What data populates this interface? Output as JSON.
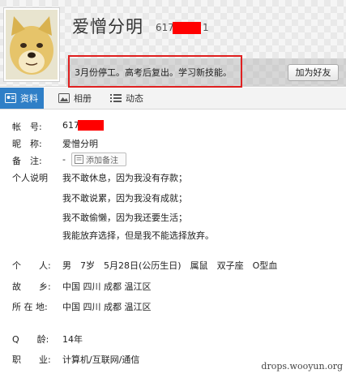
{
  "header": {
    "nickname": "爱憎分明",
    "uid_prefix": "617",
    "uid_suffix": "1",
    "signature": "3月份停工。高考后复出。学习新技能。",
    "add_friend_label": "加为好友",
    "redaction_color": "#ff0000",
    "highlight_color": "#e02020"
  },
  "tabs": [
    {
      "label": "资料",
      "icon": "profile-card-icon",
      "active": true
    },
    {
      "label": "相册",
      "icon": "photo-album-icon",
      "active": false
    },
    {
      "label": "动态",
      "icon": "feed-list-icon",
      "active": false
    }
  ],
  "profile": {
    "account_label": "帐　号:",
    "account_value": "617",
    "nickname_label": "昵　称:",
    "nickname_value": "爱憎分明",
    "remark_label": "备　注:",
    "remark_value": "-",
    "add_remark_label": "添加备注",
    "desc_label": "个人说明",
    "desc_lines": [
      "我不敢休息，因为我没有存款；",
      "我不敢说累，因为我没有成就；",
      "我不敢偷懒，因为我还要生活；",
      "我能放弃选择，但是我不能选择放弃。"
    ],
    "personal_label": "个　　人:",
    "personal_value": "男　7岁　5月28日(公历生日)　属鼠　双子座　O型血",
    "hometown_label": "故　　乡:",
    "hometown_value": "中国 四川 成都 温江区",
    "location_label": "所 在 地:",
    "location_value": "中国 四川 成都 温江区",
    "qage_label": "Q　　龄:",
    "qage_value": "14年",
    "job_label": "职　　业:",
    "job_value": "计算机/互联网/通信"
  },
  "accent_color": "#2f7fc7",
  "watermark": "drops.wooyun.org"
}
